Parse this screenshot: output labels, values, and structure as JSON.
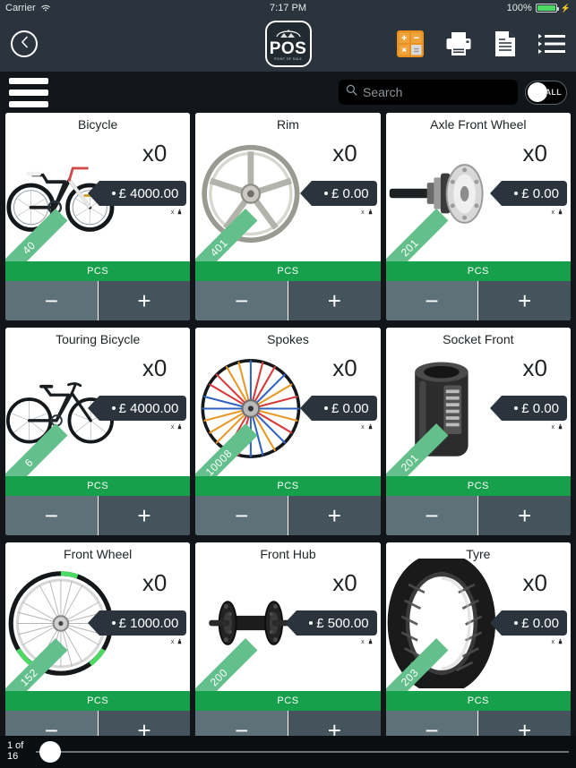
{
  "status_bar": {
    "carrier": "Carrier",
    "wifi_icon": "wifi-icon",
    "time": "7:17 PM",
    "battery_percent": "100%",
    "battery_icon": "battery-full-icon",
    "charging_icon": "lightning-bolt-icon"
  },
  "top_nav": {
    "back_icon": "chevron-left-icon",
    "logo": {
      "wordmark": "POS",
      "subtext": "POINT OF SALE"
    },
    "icons": [
      {
        "name": "calculator-icon",
        "label": "Calculator"
      },
      {
        "name": "printer-icon",
        "label": "Print"
      },
      {
        "name": "document-icon",
        "label": "Document"
      },
      {
        "name": "list-icon",
        "label": "List"
      }
    ]
  },
  "toolbar": {
    "menu_icon": "hamburger-menu-icon",
    "search": {
      "icon": "search-icon",
      "placeholder": "Search",
      "value": ""
    },
    "toggle": {
      "label": "ALL",
      "state": "off"
    }
  },
  "products": [
    {
      "title": "Bicycle",
      "quantity": "x0",
      "price": "£ 4000.00",
      "ribbon": "40",
      "unit": "PCS",
      "weight_label": "x",
      "weight_icon": "weight-icon",
      "minus": "−",
      "plus": "+",
      "art": "mountain-bicycle"
    },
    {
      "title": "Rim",
      "quantity": "x0",
      "price": "£ 0.00",
      "ribbon": "401",
      "unit": "PCS",
      "weight_label": "x",
      "weight_icon": "weight-icon",
      "minus": "−",
      "plus": "+",
      "art": "rim"
    },
    {
      "title": "Axle Front Wheel",
      "quantity": "x0",
      "price": "£ 0.00",
      "ribbon": "201",
      "unit": "PCS",
      "weight_label": "x",
      "weight_icon": "weight-icon",
      "minus": "−",
      "plus": "+",
      "art": "axle"
    },
    {
      "title": "Touring Bicycle",
      "quantity": "x0",
      "price": "£ 4000.00",
      "ribbon": "6",
      "unit": "PCS",
      "weight_label": "x",
      "weight_icon": "weight-icon",
      "minus": "−",
      "plus": "+",
      "art": "touring-bicycle"
    },
    {
      "title": "Spokes",
      "quantity": "x0",
      "price": "£ 0.00",
      "ribbon": "10008",
      "unit": "PCS",
      "weight_label": "x",
      "weight_icon": "weight-icon",
      "minus": "−",
      "plus": "+",
      "art": "spokes"
    },
    {
      "title": "Socket Front",
      "quantity": "x0",
      "price": "£ 0.00",
      "ribbon": "201",
      "unit": "PCS",
      "weight_label": "x",
      "weight_icon": "weight-icon",
      "minus": "−",
      "plus": "+",
      "art": "socket"
    },
    {
      "title": "Front Wheel",
      "quantity": "x0",
      "price": "£ 1000.00",
      "ribbon": "152",
      "unit": "PCS",
      "weight_label": "x",
      "weight_icon": "weight-icon",
      "minus": "−",
      "plus": "+",
      "art": "front-wheel"
    },
    {
      "title": "Front Hub",
      "quantity": "x0",
      "price": "£ 500.00",
      "ribbon": "200",
      "unit": "PCS",
      "weight_label": "x",
      "weight_icon": "weight-icon",
      "minus": "−",
      "plus": "+",
      "art": "front-hub"
    },
    {
      "title": "Tyre",
      "quantity": "x0",
      "price": "£ 0.00",
      "ribbon": "203",
      "unit": "PCS",
      "weight_label": "x",
      "weight_icon": "weight-icon",
      "minus": "−",
      "plus": "+",
      "art": "tyre"
    }
  ],
  "footer": {
    "page_label": "1 of 16",
    "page_current": "1",
    "page_total": "16",
    "slider_icon": "page-slider"
  },
  "colors": {
    "chrome": "#2b343c",
    "background": "#12161a",
    "accent_green": "#17a04c",
    "ribbon_green": "#63c08c",
    "orange": "#e8911f",
    "stepper_minus": "#5e7179",
    "stepper_plus": "#45545c"
  }
}
